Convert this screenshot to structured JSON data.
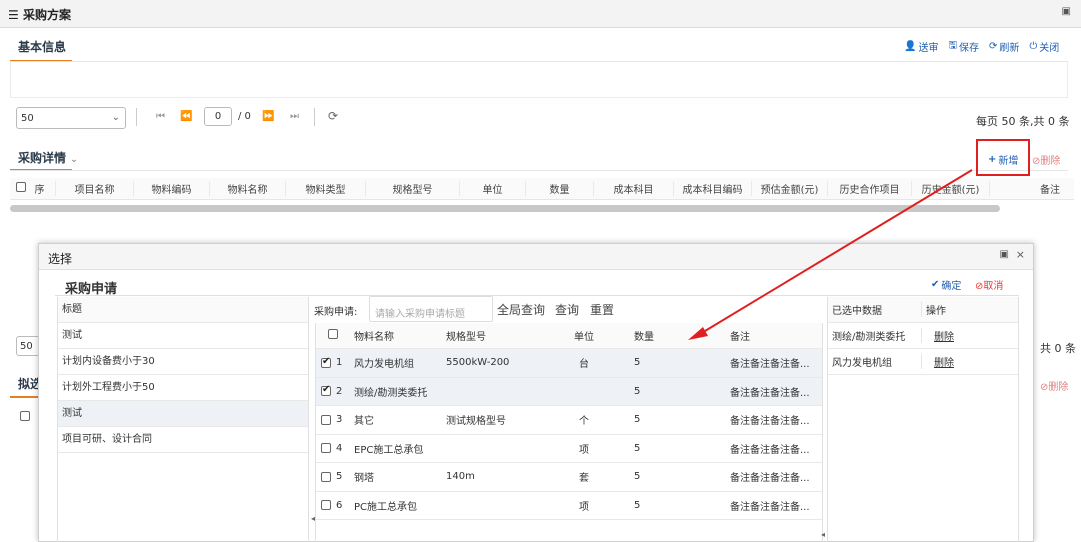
{
  "window": {
    "title": "采购方案"
  },
  "basic": {
    "title": "基本信息",
    "buttons": [
      "送审",
      "保存",
      "刷新",
      "关闭"
    ]
  },
  "pager": {
    "page_size": "50",
    "page": "0",
    "total_pages": "/ 0",
    "summary": "每页 50 条,共 0 条",
    "summary_partial": "共 0 条"
  },
  "detail": {
    "title": "采购详情",
    "add": "新增",
    "delete": "删除",
    "columns": [
      "序",
      "项目名称",
      "物料编码",
      "物料名称",
      "物料类型",
      "规格型号",
      "单位",
      "数量",
      "成本科目",
      "成本科目编码",
      "预估金额(元)",
      "历史合作项目",
      "历史金额(元)",
      "备注"
    ]
  },
  "bg2": {
    "title_partial": "拟选",
    "page_size": "50",
    "delete": "删除"
  },
  "modal": {
    "title": "选择",
    "heading": "采购申请",
    "confirm": "确定",
    "cancel": "取消",
    "left": {
      "header": "标题",
      "items": [
        "测试",
        "计划内设备费小于30",
        "计划外工程费小于50",
        "测试",
        "项目可研、设计合同"
      ],
      "selected_index": 3
    },
    "search": {
      "label": "采购申请:",
      "placeholder": "请输入采购申请标题",
      "global": "全局查询",
      "query": "查询",
      "reset": "重置"
    },
    "grid": {
      "columns": [
        "物料名称",
        "规格型号",
        "单位",
        "数量",
        "备注"
      ],
      "rows": [
        {
          "no": "1",
          "name": "风力发电机组",
          "spec": "5500kW-200",
          "unit": "台",
          "qty": "5",
          "note": "备注备注备注备...",
          "checked": true
        },
        {
          "no": "2",
          "name": "测绘/勘测类委托",
          "spec": "",
          "unit": "",
          "qty": "5",
          "note": "备注备注备注备...",
          "checked": true
        },
        {
          "no": "3",
          "name": "其它",
          "spec": "测试规格型号",
          "unit": "个",
          "qty": "5",
          "note": "备注备注备注备...",
          "checked": false
        },
        {
          "no": "4",
          "name": "EPC施工总承包",
          "spec": "",
          "unit": "项",
          "qty": "5",
          "note": "备注备注备注备...",
          "checked": false
        },
        {
          "no": "5",
          "name": "钢塔",
          "spec": "140m",
          "unit": "套",
          "qty": "5",
          "note": "备注备注备注备...",
          "checked": false
        },
        {
          "no": "6",
          "name": "PC施工总承包",
          "spec": "",
          "unit": "项",
          "qty": "5",
          "note": "备注备注备注备...",
          "checked": false
        }
      ]
    },
    "selected": {
      "header_data": "已选中数据",
      "header_op": "操作",
      "items": [
        "测绘/勘测类委托",
        "风力发电机组"
      ],
      "delete": "删除"
    }
  },
  "colors": {
    "accent": "#e67e22",
    "link": "#1f5fb4",
    "danger": "#e03c31",
    "highlight": "#e02020"
  }
}
